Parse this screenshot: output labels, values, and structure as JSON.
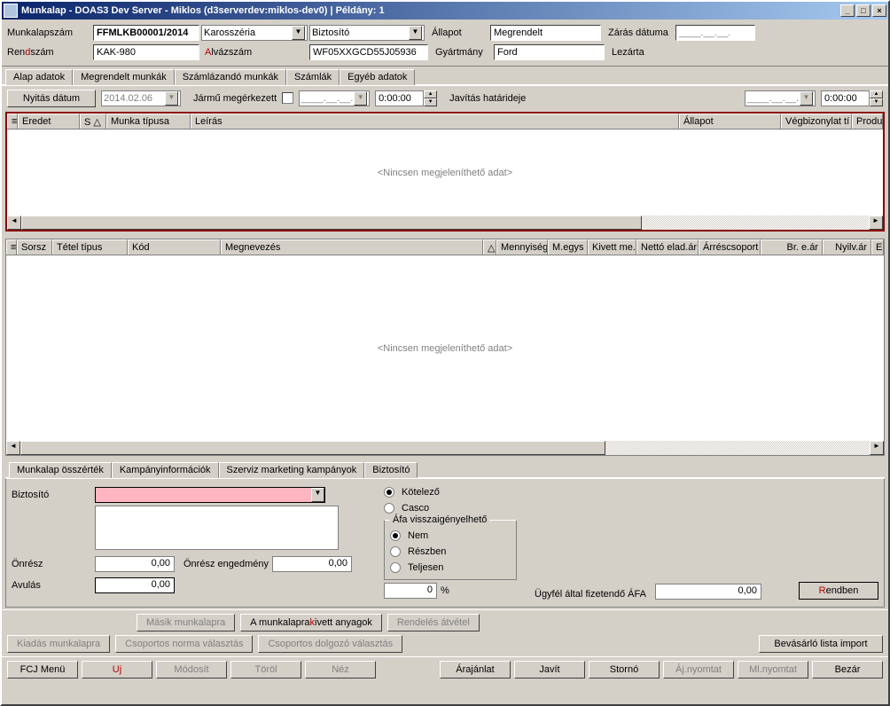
{
  "window": {
    "title": "Munkalap - DOAS3 Dev Server - Miklos (d3serverdev:miklos-dev0) | Példány: 1"
  },
  "header": {
    "munkalapszam_label": "Munkalapszám",
    "munkalapszam_value": "FFMLKB00001/2014",
    "karosszeria_label": "Karosszéria",
    "biztosito_label": "Biztosító",
    "allapot_label": "Állapot",
    "allapot_value": "Megrendelt",
    "zaras_datuma_label": "Zárás dátuma",
    "zaras_datuma_value": "____.__.__.",
    "rendszam_label_pre": "Ren",
    "rendszam_label_hk": "d",
    "rendszam_label_post": "szám",
    "rendszam_value": "KAK-980",
    "alvazszam_hk": "A",
    "alvazszam_label": "lvázszám",
    "alvazszam_value": "WF05XXGCD55J05936",
    "gyartmany_label": "Gyártmány",
    "gyartmany_value": "Ford",
    "lezarta_label": "Lezárta"
  },
  "main_tabs": [
    "Alap adatok",
    "Megrendelt munkák",
    "Számlázandó munkák",
    "Számlák",
    "Egyéb adatok"
  ],
  "main_tabs_active": 1,
  "toolbar": {
    "nyitas_datum_label": "Nyitás dátum",
    "nyitas_datum_value": "2014.02.06",
    "jarmu_label": "Jármű megérkezett",
    "date1": "____.__.__.",
    "time1": "0:00:00",
    "javitas_label": "Javítás határideje",
    "date2": "____.__.__.",
    "time2": "0:00:00"
  },
  "grid1": {
    "cols": [
      "Eredet",
      "S △",
      "Munka típusa",
      "Leírás",
      "Állapot",
      "Végbizonylat tí",
      "Produ"
    ],
    "empty": "<Nincsen megjeleníthető adat>"
  },
  "grid2": {
    "cols": [
      "Sorsz",
      "Tétel típus",
      "Kód",
      "Megnevezés",
      "△",
      "Mennyiség",
      "M.egys",
      "Kivett me.",
      "Nettó elad.ár",
      "Árréscsoport",
      "Br. e.ár",
      "Nyilv.ár",
      "E"
    ],
    "empty": "<Nincsen megjeleníthető adat>"
  },
  "bottom_tabs": [
    "Munkalap összérték",
    "Kampányinformációk",
    "Szerviz marketing kampányok",
    "Biztosító"
  ],
  "bottom_tabs_active": 3,
  "biztosito_panel": {
    "biztosito_label": "Biztosító",
    "onresz_label": "Önrész",
    "onresz_value": "0,00",
    "onresz_engedmeny_label": "Önrész engedmény",
    "onresz_engedmeny_value": "0,00",
    "avulas_label": "Avulás",
    "avulas_value": "0,00",
    "kotelezo": "Kötelező",
    "casco": "Casco",
    "afa_legend": "Áfa visszaigényelhető",
    "nem": "Nem",
    "reszben": "Részben",
    "teljesen": "Teljesen",
    "percent_value": "0",
    "percent_sign": "%",
    "ugyfel_afa_label": "Ügyfél által fizetendő ÁFA",
    "ugyfel_afa_value": "0,00",
    "rendben_hk": "R",
    "rendben": "endben"
  },
  "action_row1": {
    "masik": "Másik munkalapra",
    "kivett_pre": "A munkalapra ",
    "kivett_hk": "k",
    "kivett_post": "ivett anyagok",
    "rendeles": "Rendelés átvétel"
  },
  "action_row2": {
    "kiadas": "Kiadás munkalapra",
    "norma": "Csoportos norma választás",
    "dolgozo": "Csoportos dolgozó választás",
    "bevasarlo": "Bevásárló lista import"
  },
  "bottom_bar": {
    "fcj": "FCJ Menü",
    "uj": "Uj",
    "modosit": "Módosít",
    "torol": "Töröl",
    "nez": "Néz",
    "arajanlat": "Árajánlat",
    "javit": "Javít",
    "storno": "Stornó",
    "ajnyomtat": "Áj.nyomtat",
    "mlnyomtat": "Ml.nyomtat",
    "bezar": "Bezár"
  }
}
